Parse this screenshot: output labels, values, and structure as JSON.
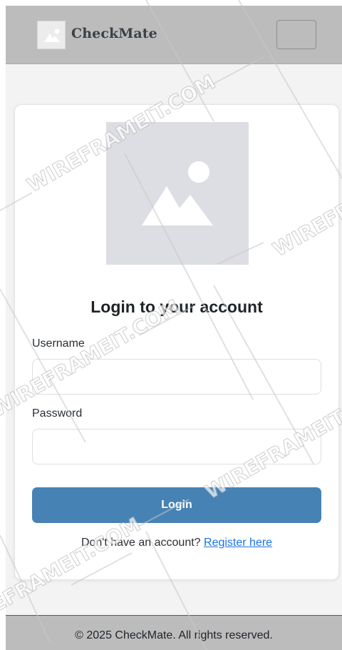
{
  "header": {
    "brand": "CheckMate",
    "logo_icon": "image-placeholder-icon",
    "menu_icon": "menu-toggle-icon"
  },
  "login_card": {
    "image_icon": "image-placeholder-icon",
    "title": "Login to your account",
    "username_label": "Username",
    "username_value": "",
    "password_label": "Password",
    "password_value": "",
    "login_button": "Login",
    "register_prompt": "Don't have an account?",
    "register_link": "Register here"
  },
  "footer": {
    "copyright": "© 2025 CheckMate. All rights reserved."
  },
  "watermark": {
    "text": "WIREFRAMEIT.COM"
  },
  "colors": {
    "header_bg": "#bcbcbc",
    "page_bg": "#f3f3f3",
    "card_bg": "#ffffff",
    "button_bg": "#4682b4",
    "link": "#1a73e8",
    "placeholder_bg": "#dddee3"
  }
}
